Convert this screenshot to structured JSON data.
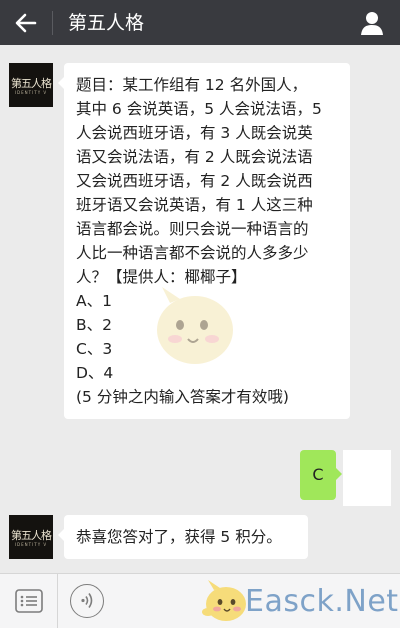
{
  "header": {
    "back_icon": "arrow-left-icon",
    "title": "第五人格",
    "user_icon": "person-icon"
  },
  "messages": [
    {
      "from": "account",
      "avatar_logo_text": "第五人格",
      "avatar_logo_sub": "IDENTITY V",
      "lines": [
        "题目：某工作组有 12 名外国人，",
        "其中 6 会说英语，5 人会说法语，5",
        "人会说西班牙语，有 3 人既会说英",
        "语又会说法语，有 2 人既会说法语",
        "又会说西班牙语，有 2 人既会说西",
        "班牙语又会说英语，有 1 人这三种",
        "语言都会说。则只会说一种语言的",
        "人比一种语言都不会说的人多多少",
        "人？【提供人：椰椰子】",
        "A、1",
        "B、2",
        "C、3",
        "D、4",
        "(5 分钟之内输入答案才有效哦)"
      ]
    },
    {
      "from": "me",
      "text": "C"
    },
    {
      "from": "account",
      "avatar_logo_text": "第五人格",
      "avatar_logo_sub": "IDENTITY V",
      "text": "恭喜您答对了，获得 5 积分。"
    }
  ],
  "bottom": {
    "menu_icon": "menu-list-icon",
    "voice_icon": "voice-icon"
  },
  "watermark": {
    "text": "Easck.Net",
    "color": "#7ea2c8"
  },
  "colors": {
    "topbar": "#393a3f",
    "background": "#ebebeb",
    "my_bubble": "#a0e75a"
  }
}
